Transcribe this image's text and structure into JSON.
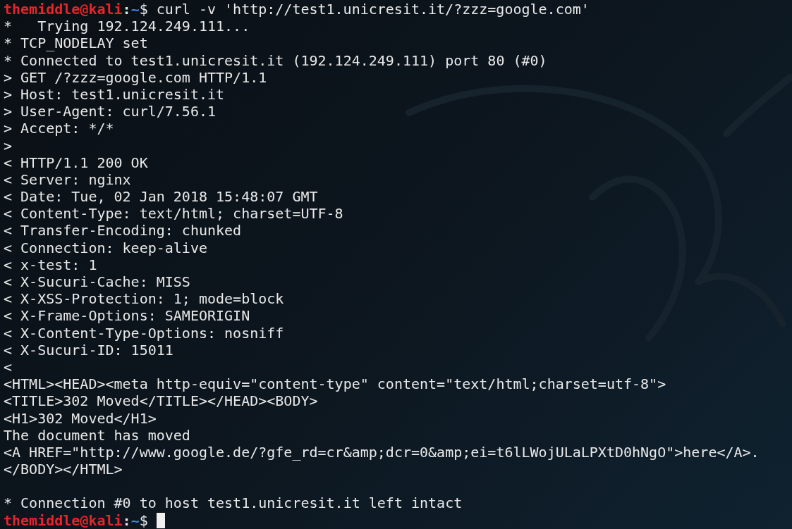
{
  "terminal": {
    "lines": [
      {
        "kind": "prompt",
        "user": "themiddle@kali",
        "separator": ":",
        "path": "~",
        "symbol": "$",
        "command": "curl -v 'http://test1.unicresit.it/?zzz=google.com'",
        "cursor": false
      },
      {
        "kind": "output",
        "text": "*   Trying 192.124.249.111..."
      },
      {
        "kind": "output",
        "text": "* TCP_NODELAY set"
      },
      {
        "kind": "output",
        "text": "* Connected to test1.unicresit.it (192.124.249.111) port 80 (#0)"
      },
      {
        "kind": "output",
        "text": "> GET /?zzz=google.com HTTP/1.1"
      },
      {
        "kind": "output",
        "text": "> Host: test1.unicresit.it"
      },
      {
        "kind": "output",
        "text": "> User-Agent: curl/7.56.1"
      },
      {
        "kind": "output",
        "text": "> Accept: */*"
      },
      {
        "kind": "output",
        "text": ">"
      },
      {
        "kind": "output",
        "text": "< HTTP/1.1 200 OK"
      },
      {
        "kind": "output",
        "text": "< Server: nginx"
      },
      {
        "kind": "output",
        "text": "< Date: Tue, 02 Jan 2018 15:48:07 GMT"
      },
      {
        "kind": "output",
        "text": "< Content-Type: text/html; charset=UTF-8"
      },
      {
        "kind": "output",
        "text": "< Transfer-Encoding: chunked"
      },
      {
        "kind": "output",
        "text": "< Connection: keep-alive"
      },
      {
        "kind": "output",
        "text": "< x-test: 1"
      },
      {
        "kind": "output",
        "text": "< X-Sucuri-Cache: MISS"
      },
      {
        "kind": "output",
        "text": "< X-XSS-Protection: 1; mode=block"
      },
      {
        "kind": "output",
        "text": "< X-Frame-Options: SAMEORIGIN"
      },
      {
        "kind": "output",
        "text": "< X-Content-Type-Options: nosniff"
      },
      {
        "kind": "output",
        "text": "< X-Sucuri-ID: 15011"
      },
      {
        "kind": "output",
        "text": "<"
      },
      {
        "kind": "output",
        "text": "<HTML><HEAD><meta http-equiv=\"content-type\" content=\"text/html;charset=utf-8\">"
      },
      {
        "kind": "output",
        "text": "<TITLE>302 Moved</TITLE></HEAD><BODY>"
      },
      {
        "kind": "output",
        "text": "<H1>302 Moved</H1>"
      },
      {
        "kind": "output",
        "text": "The document has moved"
      },
      {
        "kind": "output",
        "text": "<A HREF=\"http://www.google.de/?gfe_rd=cr&amp;dcr=0&amp;ei=t6lLWojULaLPXtD0hNgO\">here</A>."
      },
      {
        "kind": "output",
        "text": "</BODY></HTML>"
      },
      {
        "kind": "blank"
      },
      {
        "kind": "output",
        "text": "* Connection #0 to host test1.unicresit.it left intact"
      },
      {
        "kind": "prompt",
        "user": "themiddle@kali",
        "separator": ":",
        "path": "~",
        "symbol": "$",
        "cursor": true
      }
    ]
  }
}
